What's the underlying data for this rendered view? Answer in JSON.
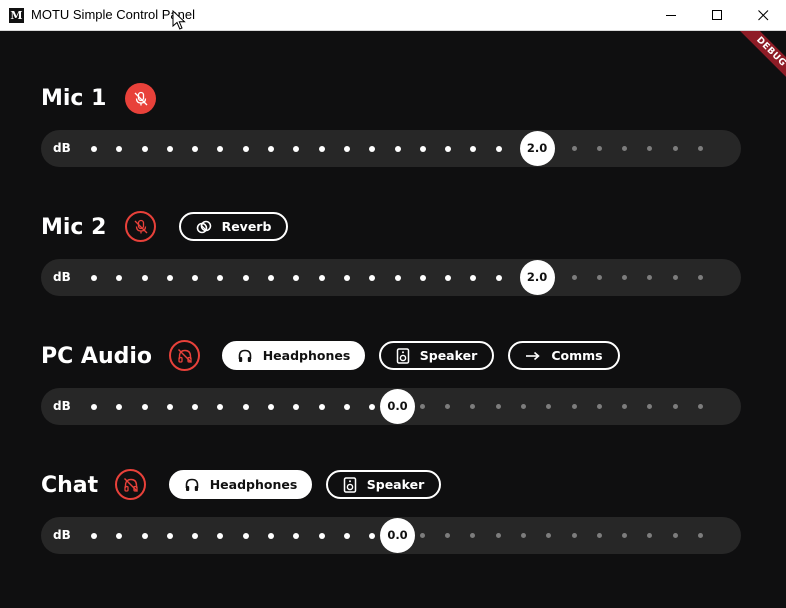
{
  "window": {
    "title": "MOTU Simple Control Panel",
    "icon_letter": "M",
    "controls": [
      "minimize-icon",
      "maximize-icon",
      "close-icon"
    ]
  },
  "debug_banner": "DEBUG",
  "colors": {
    "background": "#0f0f10",
    "mute_red": "#e8413a",
    "slider_track": "#272727",
    "ribbon": "#8e1c26"
  },
  "sections": [
    {
      "name": "Mic 1",
      "mute_icon": "mic-off-icon",
      "muted": true,
      "buttons": [],
      "slider": {
        "label": "dB",
        "value": "2.0",
        "level": 0.73
      }
    },
    {
      "name": "Mic 2",
      "mute_icon": "mic-off-icon",
      "muted": false,
      "buttons": [
        {
          "label": "Reverb",
          "icon": "reverb-icon",
          "active": false
        }
      ],
      "slider": {
        "label": "dB",
        "value": "2.0",
        "level": 0.73
      }
    },
    {
      "name": "PC Audio",
      "mute_icon": "headphones-off-icon",
      "muted": false,
      "buttons": [
        {
          "label": "Headphones",
          "icon": "headphones-icon",
          "active": true
        },
        {
          "label": "Speaker",
          "icon": "speaker-icon",
          "active": false
        },
        {
          "label": "Comms",
          "icon": "arrow-right-icon",
          "active": false
        }
      ],
      "slider": {
        "label": "dB",
        "value": "0.0",
        "level": 0.5
      }
    },
    {
      "name": "Chat",
      "mute_icon": "headphones-off-icon",
      "muted": false,
      "buttons": [
        {
          "label": "Headphones",
          "icon": "headphones-icon",
          "active": true
        },
        {
          "label": "Speaker",
          "icon": "speaker-icon",
          "active": false
        }
      ],
      "slider": {
        "label": "dB",
        "value": "0.0",
        "level": 0.5
      }
    }
  ]
}
